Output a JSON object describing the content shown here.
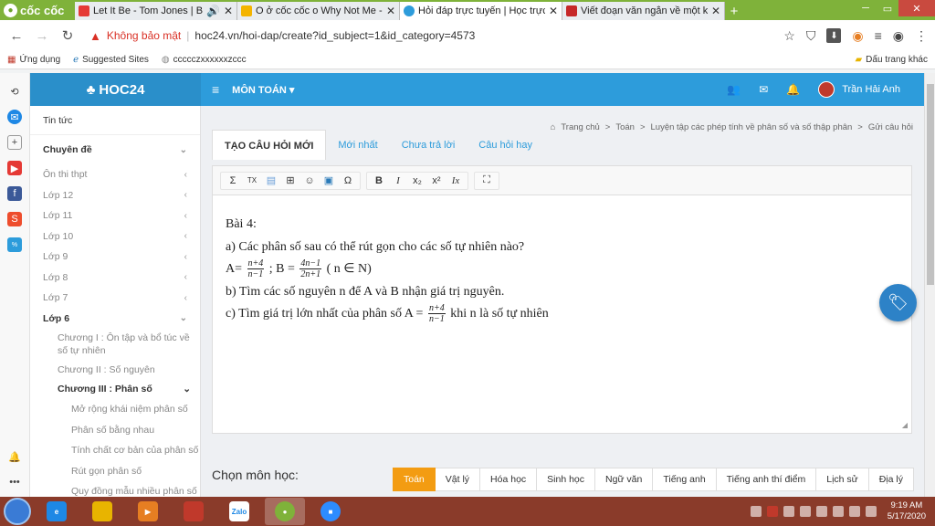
{
  "browser": {
    "name": "cốc cốc",
    "tabs": [
      {
        "title": "Let It Be - Tom Jones | Bài",
        "favicon_color": "#e53935",
        "active": false
      },
      {
        "title": "O ở cốc cốc o Why Not Me -",
        "favicon_color": "#f4b400",
        "active": false
      },
      {
        "title": "Hỏi đáp trực tuyến | Học trực",
        "favicon_color": "#2d9cdb",
        "active": true
      },
      {
        "title": "Viết đoạn văn ngắn về một kỉ",
        "favicon_color": "#c62828",
        "active": false
      }
    ],
    "new_tab_label": "+",
    "insecure_label": "Không bảo mật",
    "url": "hoc24.vn/hoi-dap/create?id_subject=1&id_category=4573",
    "bookmarks": [
      "Ứng dụng",
      "Suggested Sites",
      "ccccczxxxxxxzccc"
    ],
    "bookmarks_right": "Dấu trang khác"
  },
  "site": {
    "logo": "HOC24",
    "subject_menu": "MÔN TOÁN",
    "user_name": "Trần Hải Anh",
    "brand_color": "#2d9cdb"
  },
  "leftnav": {
    "news": "Tin tức",
    "topics": "Chuyên đề",
    "items": [
      "Ôn thi thpt",
      "Lớp 12",
      "Lớp 11",
      "Lớp 10",
      "Lớp 9",
      "Lớp 8",
      "Lớp 7"
    ],
    "current_grade": "Lớp 6",
    "chapters": [
      "Chương I : Ôn tập và bổ túc về số tự nhiên",
      "Chương II : Số nguyên"
    ],
    "current_chapter": "Chương III : Phân số",
    "lessons": [
      "Mở rộng khái niệm phân số",
      "Phân số bằng nhau",
      "Tính chất cơ bản của phân số",
      "Rút gọn phân số",
      "Quy đồng mẫu nhiều phân số"
    ]
  },
  "breadcrumb": [
    "Trang chủ",
    "Toán",
    "Luyện tập các phép tính về phân số và số thập phân",
    "Gửi câu hỏi"
  ],
  "question_tabs": [
    "TẠO CÂU HỎI MỚI",
    "Mới nhất",
    "Chưa trả lời",
    "Câu hỏi hay"
  ],
  "editor": {
    "line1": "Bài 4:",
    "line2": "a) Các phân số sau có thể rút gọn cho các số tự nhiên nào?",
    "line3_a": "A=",
    "frac1_num": "n+4",
    "frac1_den": "n−1",
    "line3_b": "; B =",
    "frac2_num": "4n−1",
    "frac2_den": "2n+1",
    "line3_c": "( n ∈ N)",
    "line4": "b) Tìm các số nguyên n để A và B nhận giá trị nguyên.",
    "line5_a": "c) Tìm giá trị lớn nhất của phân số A =",
    "frac3_num": "n+4",
    "frac3_den": "n−1",
    "line5_b": "khi n là số tự nhiên"
  },
  "choose_subject_label": "Chọn môn học:",
  "subjects": [
    "Toán",
    "Vật lý",
    "Hóa học",
    "Sinh học",
    "Ngữ văn",
    "Tiếng anh",
    "Tiếng anh thí điểm",
    "Lịch sử",
    "Địa lý"
  ],
  "active_subject_color": "#f39c12",
  "taskbar": {
    "time": "9:19 AM",
    "date": "5/17/2020",
    "zalo_label": "Zalo"
  }
}
